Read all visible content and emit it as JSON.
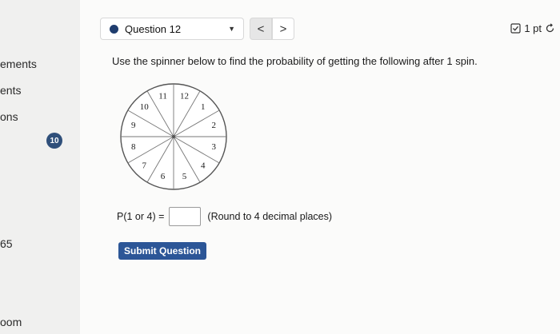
{
  "sidebar": {
    "items": [
      {
        "label": "ements"
      },
      {
        "label": "ents"
      },
      {
        "label": "ons"
      },
      {
        "label": "65"
      },
      {
        "label": "oom"
      }
    ],
    "badge": "10"
  },
  "header": {
    "question_label": "Question 12",
    "prev_icon": "<",
    "next_icon": ">",
    "points": "1 pt"
  },
  "main": {
    "instruction": "Use the spinner below to find the probability of getting the following after 1 spin.",
    "spinner_numbers": [
      "12",
      "1",
      "2",
      "3",
      "4",
      "5",
      "6",
      "7",
      "8",
      "9",
      "10",
      "11"
    ],
    "question_text": "P(1 or 4) =",
    "answer_value": "",
    "hint": "(Round to 4 decimal places)",
    "submit_label": "Submit Question"
  }
}
